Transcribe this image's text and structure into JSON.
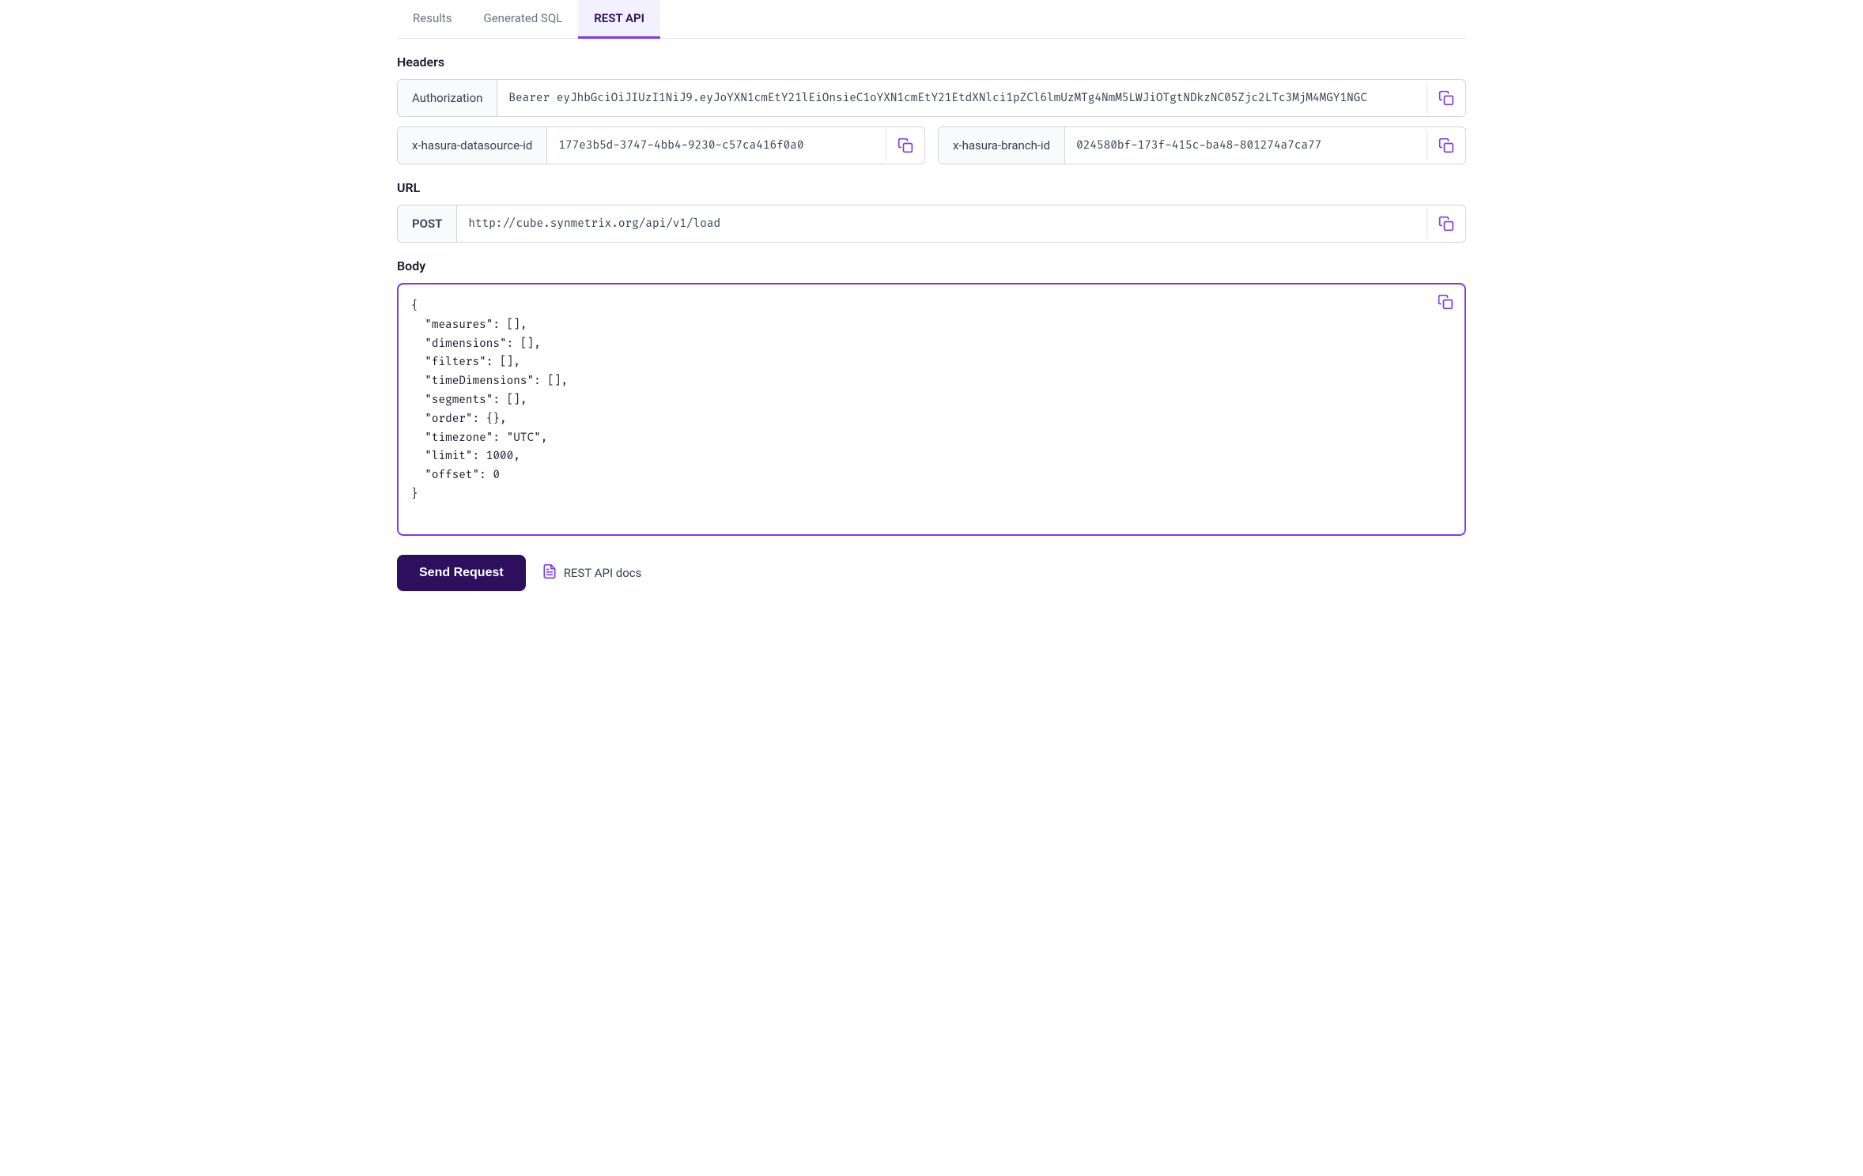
{
  "tabs": [
    {
      "id": "results",
      "label": "Results",
      "active": false
    },
    {
      "id": "generated-sql",
      "label": "Generated SQL",
      "active": false
    },
    {
      "id": "rest-api",
      "label": "REST API",
      "active": true
    }
  ],
  "headers": {
    "section_label": "Headers",
    "authorization": {
      "key": "Authorization",
      "value": "Bearer eyJhbGciOiJIUzI1NiJ9.eyJoYXN1cmEtY21lEiOnsieC1oYXN1cmEtY21EtdXNlci1pZCl6lmUzMTg4NmM5LWJiOTgtNDkzNC05Zjc2LTc3MjM4MGY1NGC"
    },
    "datasource": {
      "key": "x-hasura-datasource-id",
      "value": "177e3b5d-3747-4bb4-9230-c57ca416f0a0"
    },
    "branch": {
      "key": "x-hasura-branch-id",
      "value": "024580bf-173f-415c-ba48-801274a7ca77"
    }
  },
  "url": {
    "section_label": "URL",
    "method": "POST",
    "value": "http://cube.synmetrix.org/api/v1/load"
  },
  "body": {
    "section_label": "Body",
    "content": "{\n  \"measures\": [],\n  \"dimensions\": [],\n  \"filters\": [],\n  \"timeDimensions\": [],\n  \"segments\": [],\n  \"order\": {},\n  \"timezone\": \"UTC\",\n  \"limit\": 1000,\n  \"offset\": 0\n}"
  },
  "buttons": {
    "send_request": "Send Request",
    "rest_api_docs": "REST API docs"
  }
}
